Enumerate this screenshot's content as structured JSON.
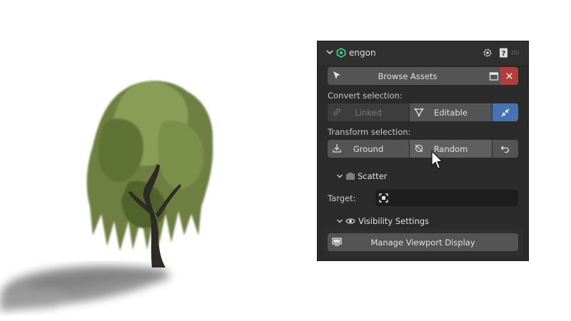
{
  "panel": {
    "title": "engon",
    "browse_assets_label": "Browse Assets",
    "convert_label": "Convert selection:",
    "convert_buttons": {
      "linked": "Linked",
      "editable": "Editable"
    },
    "transform_label": "Transform selection:",
    "transform_buttons": {
      "ground": "Ground",
      "random": "Random"
    },
    "scatter_title": "Scatter",
    "target_label": "Target:",
    "visibility_title": "Visibility Settings",
    "manage_viewport_label": "Manage Viewport Display"
  },
  "colors": {
    "panel_bg": "#2b2b2b",
    "button_bg": "#545454",
    "accent_blue": "#4772b3",
    "close_red": "#b43c3c",
    "logo_green": "#36d07a"
  },
  "icons": [
    "chevron-down-icon",
    "engon-logo-icon",
    "settings-icon",
    "help-icon",
    "drag-grip-icon",
    "cursor-arrow-icon",
    "window-icon",
    "close-icon",
    "link-icon",
    "editable-icon",
    "shrink-icon",
    "ground-icon",
    "random-icon",
    "undo-icon",
    "scatter-icon",
    "target-icon",
    "eye-icon",
    "monitor-icon",
    "mouse-cursor-icon"
  ]
}
